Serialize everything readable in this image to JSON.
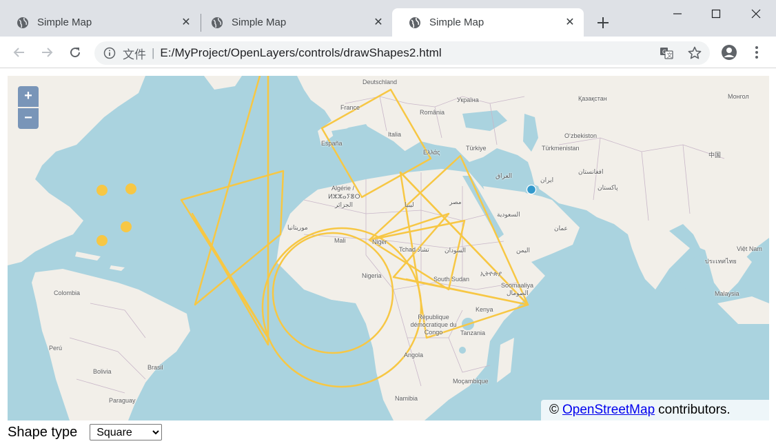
{
  "browser": {
    "tabs": [
      {
        "title": "Simple Map",
        "active": false
      },
      {
        "title": "Simple Map",
        "active": false
      },
      {
        "title": "Simple Map",
        "active": true
      }
    ],
    "new_tab_icon": "plus-icon",
    "window_controls": [
      "minimize-icon",
      "maximize-icon",
      "close-icon"
    ],
    "address": {
      "scheme_label": "文件",
      "url": "E:/MyProject/OpenLayers/controls/drawShapes2.html"
    }
  },
  "map": {
    "zoom_in": "+",
    "zoom_out": "−",
    "labels": {
      "deutschland": "Deutschland",
      "ukraina": "Україна",
      "kazakhstan": "Қазақстан",
      "mongolia": "Монгол",
      "france": "France",
      "romania": "România",
      "uzbekistan": "O‘zbekiston",
      "espana": "España",
      "italia": "Italia",
      "turkiye": "Türkiye",
      "turkmenistan": "Türkmenistan",
      "china": "中国",
      "greece": "Ελλάς",
      "afghanistan": "افغانستان",
      "iraq": "العراق",
      "iran": "ایران",
      "pakistan": "پاکستان",
      "algerie": "Algérie /",
      "algerie_tifinagh": "ⵍⵣⵣⴰⵢⴻⵔ",
      "algeria_ar": "الجزائر",
      "libya": "ليبيا",
      "egypt": "مصر",
      "saudi": "السعودية",
      "oman": "عمان",
      "mauritania": "موريتانيا",
      "mali": "Mali",
      "niger": "Niger",
      "tchad": "Tchad تشاد",
      "sudan": "السودان",
      "yemen": "اليمن",
      "vietnam": "Việt Nam",
      "thailand": "ประเทศไทย",
      "nigeria": "Nigeria",
      "south_sudan": "South Sudan",
      "ethiopia": "ኢትዮጵያ",
      "somalia": "Soomaaliya",
      "somalia_ar": "الصومال",
      "malaysia": "Malaysia",
      "colombia": "Colombia",
      "kenya": "Kenya",
      "rdc": "République démocratique du Congo",
      "tanzania": "Tanzania",
      "peru": "Perú",
      "brasil": "Brasil",
      "bolivia": "Bolivia",
      "angola": "Angola",
      "mocambique": "Moçambique",
      "paraguay": "Paraguay",
      "namibia": "Namibia"
    },
    "shape_color": "#f7c744",
    "marker_color": "#3399cc",
    "attribution": {
      "prefix": "©",
      "link": "OpenStreetMap",
      "suffix": "contributors."
    }
  },
  "form": {
    "shape_type_label": "Shape type",
    "shape_type_value": "Square"
  }
}
